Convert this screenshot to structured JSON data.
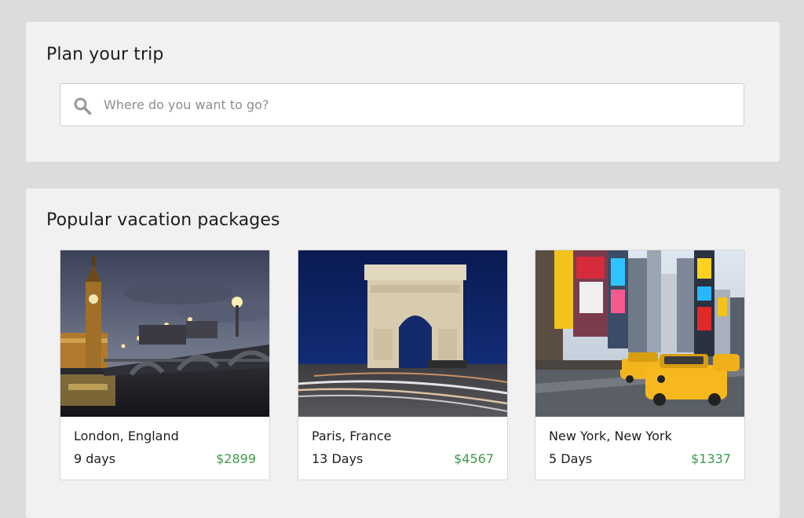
{
  "search_section": {
    "title": "Plan your trip",
    "placeholder": "Where do you want to go?",
    "value": "",
    "icon": "search-icon"
  },
  "packages_section": {
    "title": "Popular vacation packages",
    "packages": [
      {
        "city": "London, England",
        "duration": "9 days",
        "price": "$2899",
        "image": "london-photo"
      },
      {
        "city": "Paris, France",
        "duration": "13 Days",
        "price": "$4567",
        "image": "paris-photo"
      },
      {
        "city": "New York, New York",
        "duration": "5 Days",
        "price": "$1337",
        "image": "new-york-photo"
      }
    ]
  },
  "colors": {
    "page_background": "#dcdcdc",
    "panel_background": "#f1f1f1",
    "price": "#3f9a4a"
  }
}
